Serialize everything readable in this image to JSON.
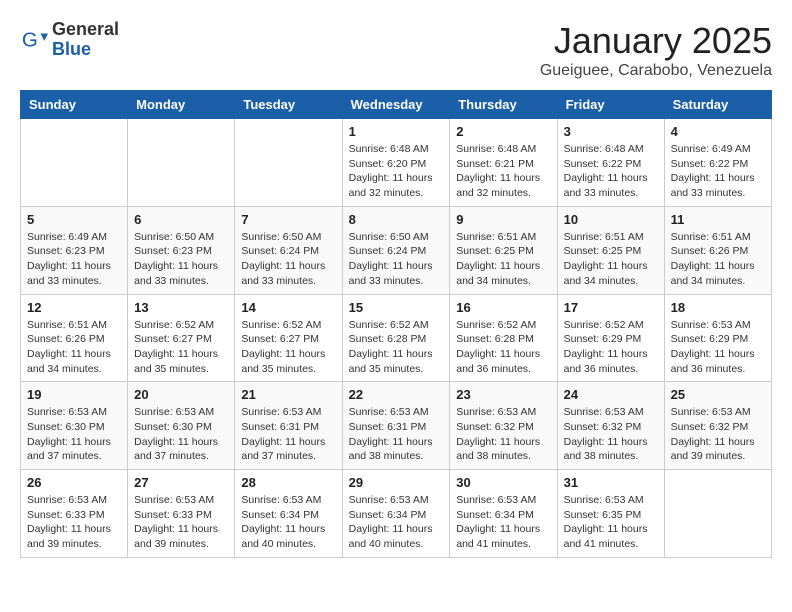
{
  "header": {
    "logo_general": "General",
    "logo_blue": "Blue",
    "month_title": "January 2025",
    "subtitle": "Gueiguee, Carabobo, Venezuela"
  },
  "days_of_week": [
    "Sunday",
    "Monday",
    "Tuesday",
    "Wednesday",
    "Thursday",
    "Friday",
    "Saturday"
  ],
  "weeks": [
    [
      {
        "day": "",
        "info": ""
      },
      {
        "day": "",
        "info": ""
      },
      {
        "day": "",
        "info": ""
      },
      {
        "day": "1",
        "info": "Sunrise: 6:48 AM\nSunset: 6:20 PM\nDaylight: 11 hours and 32 minutes."
      },
      {
        "day": "2",
        "info": "Sunrise: 6:48 AM\nSunset: 6:21 PM\nDaylight: 11 hours and 32 minutes."
      },
      {
        "day": "3",
        "info": "Sunrise: 6:48 AM\nSunset: 6:22 PM\nDaylight: 11 hours and 33 minutes."
      },
      {
        "day": "4",
        "info": "Sunrise: 6:49 AM\nSunset: 6:22 PM\nDaylight: 11 hours and 33 minutes."
      }
    ],
    [
      {
        "day": "5",
        "info": "Sunrise: 6:49 AM\nSunset: 6:23 PM\nDaylight: 11 hours and 33 minutes."
      },
      {
        "day": "6",
        "info": "Sunrise: 6:50 AM\nSunset: 6:23 PM\nDaylight: 11 hours and 33 minutes."
      },
      {
        "day": "7",
        "info": "Sunrise: 6:50 AM\nSunset: 6:24 PM\nDaylight: 11 hours and 33 minutes."
      },
      {
        "day": "8",
        "info": "Sunrise: 6:50 AM\nSunset: 6:24 PM\nDaylight: 11 hours and 33 minutes."
      },
      {
        "day": "9",
        "info": "Sunrise: 6:51 AM\nSunset: 6:25 PM\nDaylight: 11 hours and 34 minutes."
      },
      {
        "day": "10",
        "info": "Sunrise: 6:51 AM\nSunset: 6:25 PM\nDaylight: 11 hours and 34 minutes."
      },
      {
        "day": "11",
        "info": "Sunrise: 6:51 AM\nSunset: 6:26 PM\nDaylight: 11 hours and 34 minutes."
      }
    ],
    [
      {
        "day": "12",
        "info": "Sunrise: 6:51 AM\nSunset: 6:26 PM\nDaylight: 11 hours and 34 minutes."
      },
      {
        "day": "13",
        "info": "Sunrise: 6:52 AM\nSunset: 6:27 PM\nDaylight: 11 hours and 35 minutes."
      },
      {
        "day": "14",
        "info": "Sunrise: 6:52 AM\nSunset: 6:27 PM\nDaylight: 11 hours and 35 minutes."
      },
      {
        "day": "15",
        "info": "Sunrise: 6:52 AM\nSunset: 6:28 PM\nDaylight: 11 hours and 35 minutes."
      },
      {
        "day": "16",
        "info": "Sunrise: 6:52 AM\nSunset: 6:28 PM\nDaylight: 11 hours and 36 minutes."
      },
      {
        "day": "17",
        "info": "Sunrise: 6:52 AM\nSunset: 6:29 PM\nDaylight: 11 hours and 36 minutes."
      },
      {
        "day": "18",
        "info": "Sunrise: 6:53 AM\nSunset: 6:29 PM\nDaylight: 11 hours and 36 minutes."
      }
    ],
    [
      {
        "day": "19",
        "info": "Sunrise: 6:53 AM\nSunset: 6:30 PM\nDaylight: 11 hours and 37 minutes."
      },
      {
        "day": "20",
        "info": "Sunrise: 6:53 AM\nSunset: 6:30 PM\nDaylight: 11 hours and 37 minutes."
      },
      {
        "day": "21",
        "info": "Sunrise: 6:53 AM\nSunset: 6:31 PM\nDaylight: 11 hours and 37 minutes."
      },
      {
        "day": "22",
        "info": "Sunrise: 6:53 AM\nSunset: 6:31 PM\nDaylight: 11 hours and 38 minutes."
      },
      {
        "day": "23",
        "info": "Sunrise: 6:53 AM\nSunset: 6:32 PM\nDaylight: 11 hours and 38 minutes."
      },
      {
        "day": "24",
        "info": "Sunrise: 6:53 AM\nSunset: 6:32 PM\nDaylight: 11 hours and 38 minutes."
      },
      {
        "day": "25",
        "info": "Sunrise: 6:53 AM\nSunset: 6:32 PM\nDaylight: 11 hours and 39 minutes."
      }
    ],
    [
      {
        "day": "26",
        "info": "Sunrise: 6:53 AM\nSunset: 6:33 PM\nDaylight: 11 hours and 39 minutes."
      },
      {
        "day": "27",
        "info": "Sunrise: 6:53 AM\nSunset: 6:33 PM\nDaylight: 11 hours and 39 minutes."
      },
      {
        "day": "28",
        "info": "Sunrise: 6:53 AM\nSunset: 6:34 PM\nDaylight: 11 hours and 40 minutes."
      },
      {
        "day": "29",
        "info": "Sunrise: 6:53 AM\nSunset: 6:34 PM\nDaylight: 11 hours and 40 minutes."
      },
      {
        "day": "30",
        "info": "Sunrise: 6:53 AM\nSunset: 6:34 PM\nDaylight: 11 hours and 41 minutes."
      },
      {
        "day": "31",
        "info": "Sunrise: 6:53 AM\nSunset: 6:35 PM\nDaylight: 11 hours and 41 minutes."
      },
      {
        "day": "",
        "info": ""
      }
    ]
  ]
}
